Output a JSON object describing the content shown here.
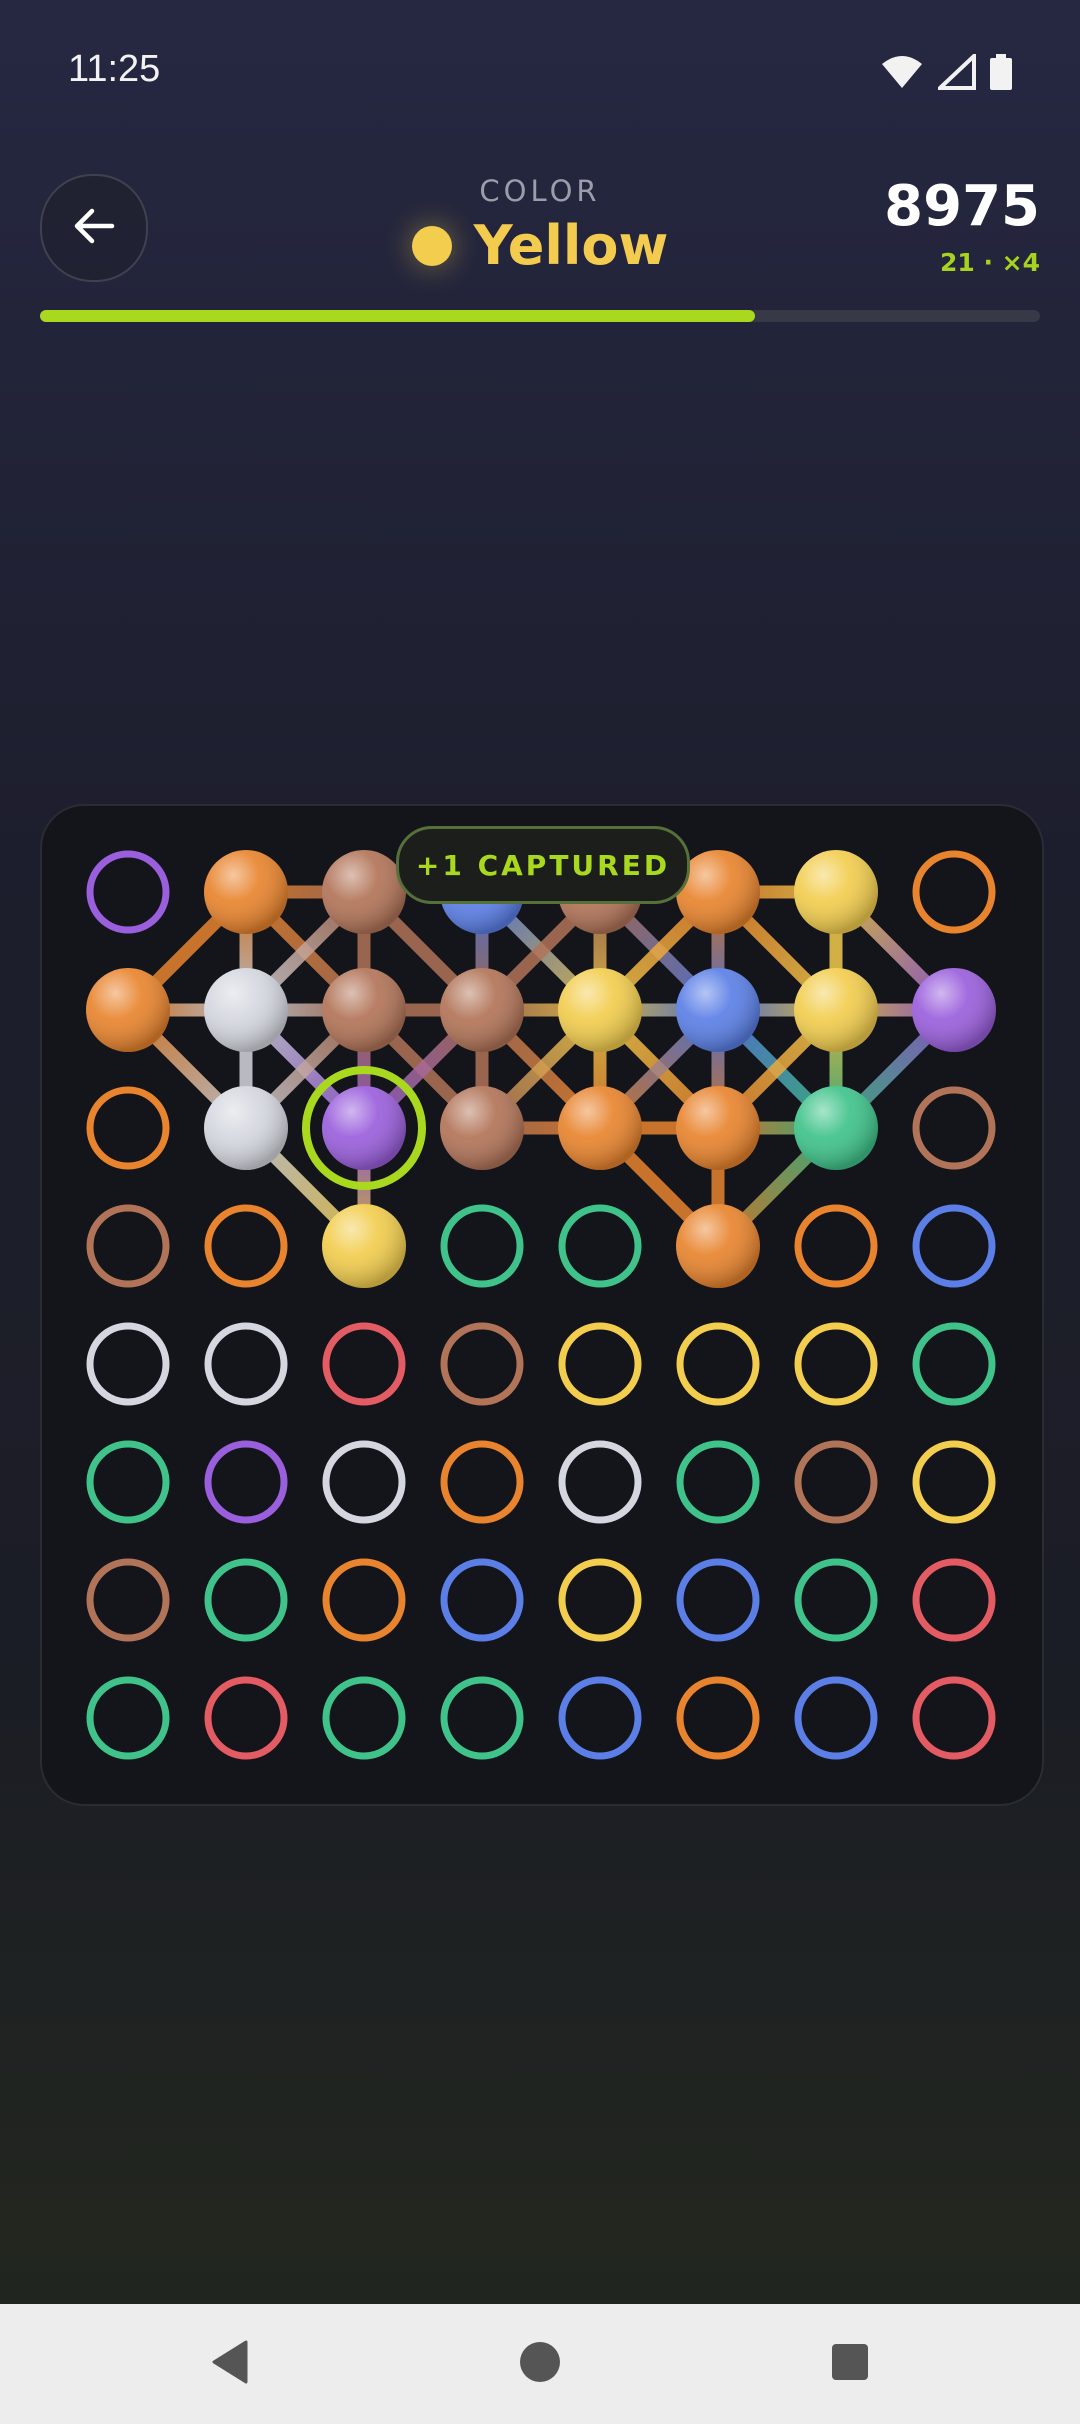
{
  "status": {
    "time": "11:25",
    "icons": [
      "wifi-icon",
      "signal-icon",
      "battery-icon"
    ]
  },
  "header": {
    "back_icon": "arrow-left-icon",
    "color_caption": "COLOR",
    "color_name": "Yellow",
    "color_hex": "#f2cd4e",
    "score": "8975",
    "score_sub": "21 · ×4"
  },
  "progress": {
    "fraction": 0.715,
    "color": "#a9d91e"
  },
  "badge": {
    "text": "+1 CAPTURED"
  },
  "palette": {
    "P": "#9a5fdc",
    "O": "#e8842e",
    "B": "#b27458",
    "U": "#5b7fe6",
    "Y": "#f2cd4e",
    "W": "#d4d7df",
    "G": "#3fc38a",
    "R": "#e35c64"
  },
  "board": {
    "rows": [
      [
        "P",
        "O",
        "B",
        "U",
        "B",
        "O",
        "Y",
        "O"
      ],
      [
        "O",
        "W",
        "B",
        "B",
        "Y",
        "U",
        "Y",
        "P"
      ],
      [
        "O",
        "W",
        "P",
        "B",
        "O",
        "O",
        "G",
        "B"
      ],
      [
        "B",
        "O",
        "Y",
        "G",
        "G",
        "O",
        "O",
        "U"
      ],
      [
        "W",
        "W",
        "R",
        "B",
        "Y",
        "Y",
        "Y",
        "G"
      ],
      [
        "G",
        "P",
        "W",
        "O",
        "W",
        "G",
        "B",
        "Y"
      ],
      [
        "B",
        "G",
        "O",
        "U",
        "Y",
        "U",
        "G",
        "R"
      ],
      [
        "G",
        "R",
        "G",
        "G",
        "U",
        "O",
        "U",
        "R"
      ]
    ],
    "filled": [
      [
        0,
        1
      ],
      [
        0,
        2
      ],
      [
        0,
        3
      ],
      [
        0,
        4
      ],
      [
        0,
        5
      ],
      [
        0,
        6
      ],
      [
        1,
        0
      ],
      [
        1,
        1
      ],
      [
        1,
        2
      ],
      [
        1,
        3
      ],
      [
        1,
        4
      ],
      [
        1,
        5
      ],
      [
        1,
        6
      ],
      [
        1,
        7
      ],
      [
        2,
        1
      ],
      [
        2,
        2
      ],
      [
        2,
        3
      ],
      [
        2,
        4
      ],
      [
        2,
        5
      ],
      [
        2,
        6
      ],
      [
        3,
        2
      ],
      [
        3,
        5
      ]
    ],
    "selected": [
      2,
      2
    ],
    "links": [
      [
        [
          1,
          0
        ],
        [
          0,
          1
        ]
      ],
      [
        [
          1,
          0
        ],
        [
          1,
          1
        ]
      ],
      [
        [
          1,
          0
        ],
        [
          2,
          1
        ]
      ],
      [
        [
          0,
          1
        ],
        [
          0,
          2
        ]
      ],
      [
        [
          0,
          1
        ],
        [
          1,
          1
        ]
      ],
      [
        [
          0,
          1
        ],
        [
          1,
          2
        ]
      ],
      [
        [
          0,
          2
        ],
        [
          1,
          1
        ]
      ],
      [
        [
          0,
          2
        ],
        [
          1,
          2
        ]
      ],
      [
        [
          0,
          2
        ],
        [
          1,
          3
        ]
      ],
      [
        [
          0,
          3
        ],
        [
          1,
          3
        ]
      ],
      [
        [
          0,
          3
        ],
        [
          1,
          4
        ]
      ],
      [
        [
          0,
          4
        ],
        [
          1,
          3
        ]
      ],
      [
        [
          0,
          4
        ],
        [
          1,
          4
        ]
      ],
      [
        [
          0,
          4
        ],
        [
          1,
          5
        ]
      ],
      [
        [
          0,
          5
        ],
        [
          1,
          4
        ]
      ],
      [
        [
          0,
          5
        ],
        [
          1,
          5
        ]
      ],
      [
        [
          0,
          5
        ],
        [
          0,
          6
        ]
      ],
      [
        [
          0,
          5
        ],
        [
          1,
          6
        ]
      ],
      [
        [
          0,
          6
        ],
        [
          1,
          6
        ]
      ],
      [
        [
          0,
          6
        ],
        [
          1,
          7
        ]
      ],
      [
        [
          1,
          1
        ],
        [
          1,
          2
        ]
      ],
      [
        [
          1,
          1
        ],
        [
          2,
          1
        ]
      ],
      [
        [
          1,
          1
        ],
        [
          2,
          2
        ]
      ],
      [
        [
          1,
          2
        ],
        [
          1,
          3
        ]
      ],
      [
        [
          1,
          2
        ],
        [
          2,
          1
        ]
      ],
      [
        [
          1,
          2
        ],
        [
          2,
          2
        ]
      ],
      [
        [
          1,
          2
        ],
        [
          2,
          3
        ]
      ],
      [
        [
          1,
          3
        ],
        [
          1,
          4
        ]
      ],
      [
        [
          1,
          3
        ],
        [
          2,
          2
        ]
      ],
      [
        [
          1,
          3
        ],
        [
          2,
          3
        ]
      ],
      [
        [
          1,
          3
        ],
        [
          2,
          4
        ]
      ],
      [
        [
          1,
          4
        ],
        [
          1,
          5
        ]
      ],
      [
        [
          1,
          4
        ],
        [
          2,
          3
        ]
      ],
      [
        [
          1,
          4
        ],
        [
          2,
          4
        ]
      ],
      [
        [
          1,
          4
        ],
        [
          2,
          5
        ]
      ],
      [
        [
          1,
          5
        ],
        [
          1,
          6
        ]
      ],
      [
        [
          1,
          5
        ],
        [
          2,
          4
        ]
      ],
      [
        [
          1,
          5
        ],
        [
          2,
          5
        ]
      ],
      [
        [
          1,
          5
        ],
        [
          2,
          6
        ]
      ],
      [
        [
          1,
          6
        ],
        [
          1,
          7
        ]
      ],
      [
        [
          1,
          6
        ],
        [
          2,
          5
        ]
      ],
      [
        [
          1,
          6
        ],
        [
          2,
          6
        ]
      ],
      [
        [
          1,
          7
        ],
        [
          2,
          6
        ]
      ],
      [
        [
          2,
          1
        ],
        [
          3,
          2
        ]
      ],
      [
        [
          2,
          2
        ],
        [
          3,
          2
        ]
      ],
      [
        [
          2,
          3
        ],
        [
          2,
          4
        ]
      ],
      [
        [
          2,
          4
        ],
        [
          2,
          5
        ]
      ],
      [
        [
          2,
          5
        ],
        [
          2,
          6
        ]
      ],
      [
        [
          2,
          4
        ],
        [
          3,
          5
        ]
      ],
      [
        [
          2,
          5
        ],
        [
          3,
          5
        ]
      ],
      [
        [
          2,
          6
        ],
        [
          3,
          5
        ]
      ]
    ]
  },
  "nav": {
    "back_icon": "triangle-back-icon",
    "home_icon": "circle-home-icon",
    "recents_icon": "square-recents-icon"
  }
}
